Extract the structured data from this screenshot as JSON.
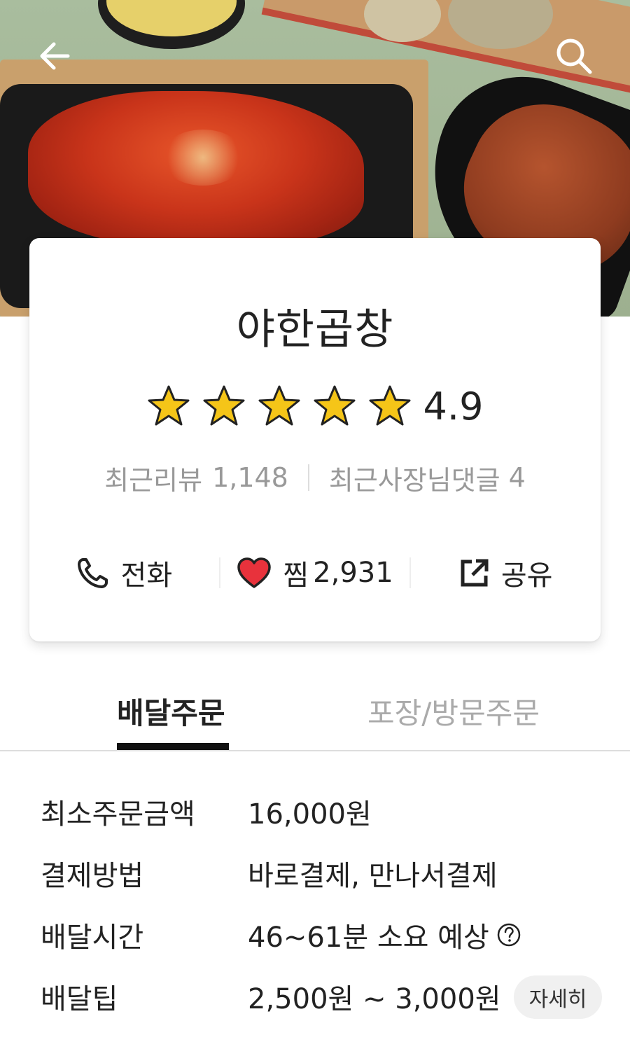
{
  "header": {
    "back_icon": "arrow-left-icon",
    "search_icon": "search-icon"
  },
  "store": {
    "name": "야한곱창",
    "rating": "4.9",
    "stars": 5,
    "star_color": "#f5c518",
    "recent_reviews_label": "최근리뷰",
    "recent_reviews_count": "1,148",
    "owner_replies_label": "최근사장님댓글",
    "owner_replies_count": "4"
  },
  "actions": {
    "call_label": "전화",
    "favorite_label": "찜",
    "favorite_count": "2,931",
    "share_label": "공유",
    "heart_color": "#e8323c"
  },
  "tabs": {
    "delivery": "배달주문",
    "pickup": "포장/방문주문"
  },
  "info": {
    "min_order_label": "최소주문금액",
    "min_order_value": "16,000원",
    "payment_label": "결제방법",
    "payment_value": "바로결제, 만나서결제",
    "delivery_time_label": "배달시간",
    "delivery_time_value": "46~61분 소요 예상",
    "delivery_tip_label": "배달팁",
    "delivery_tip_value": "2,500원 ~ 3,000원",
    "detail_button": "자세히"
  }
}
